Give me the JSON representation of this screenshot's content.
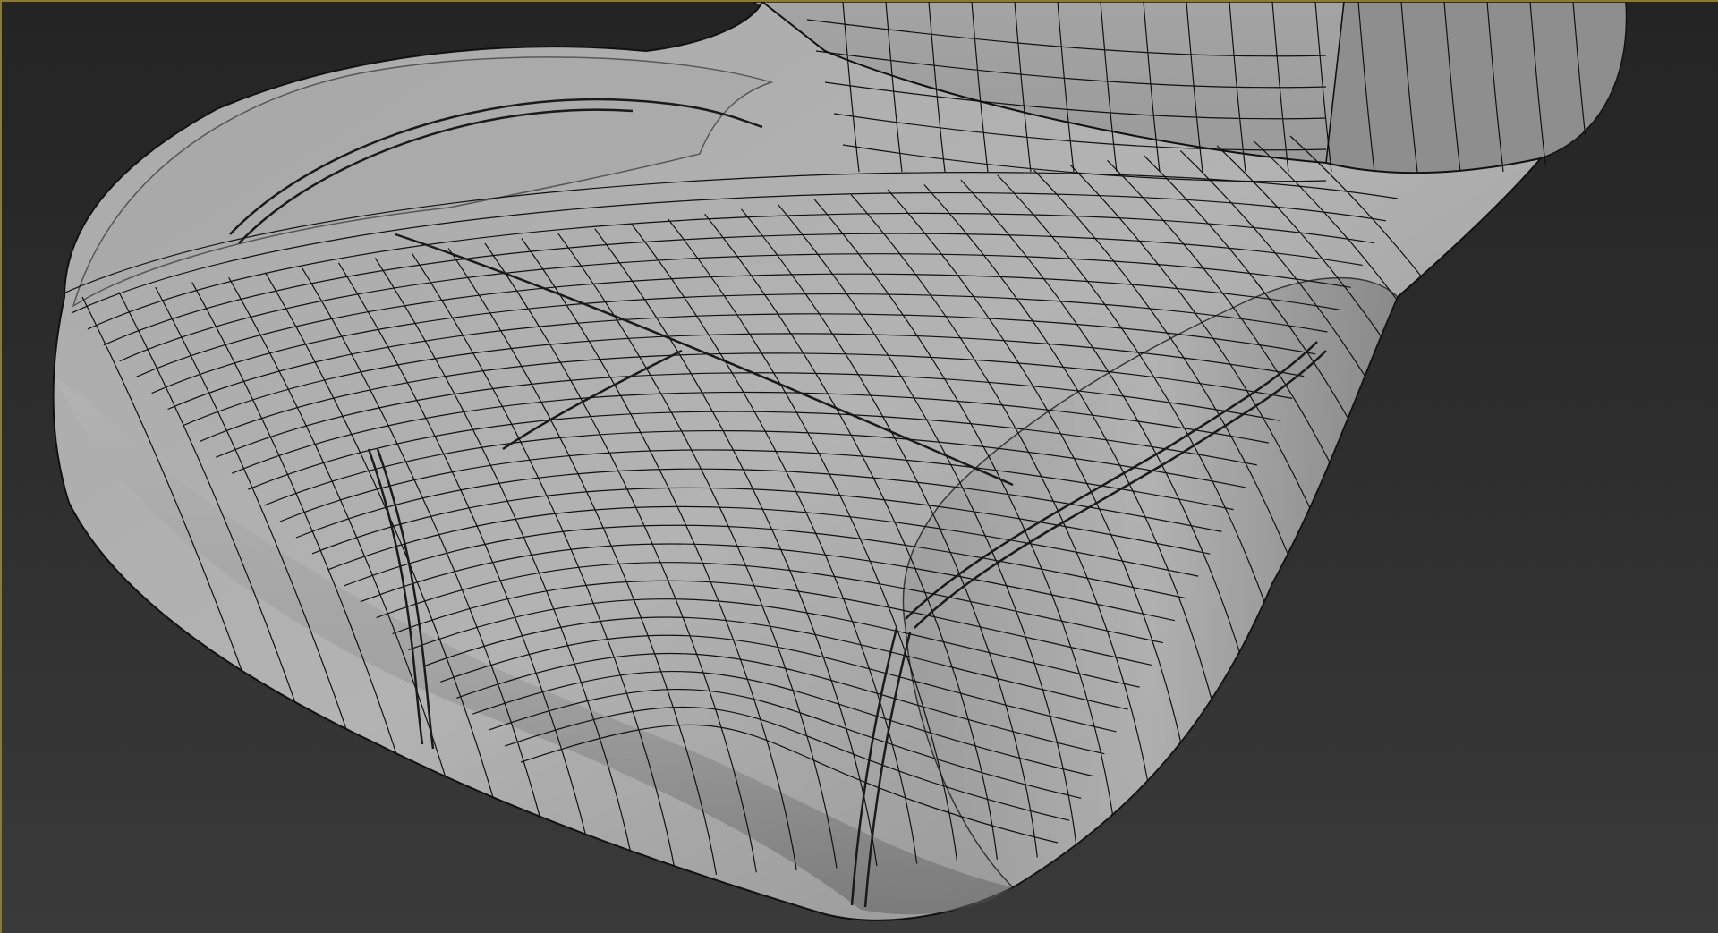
{
  "viewport": {
    "active_border_color": "#8a7a3a",
    "background_color": "#2b2b2b",
    "shading_mode": "shaded-with-wireframe",
    "wire_color": "#101010",
    "model_color": "#9a9a9a"
  },
  "model": {
    "object": "seat-cushion-mesh"
  }
}
